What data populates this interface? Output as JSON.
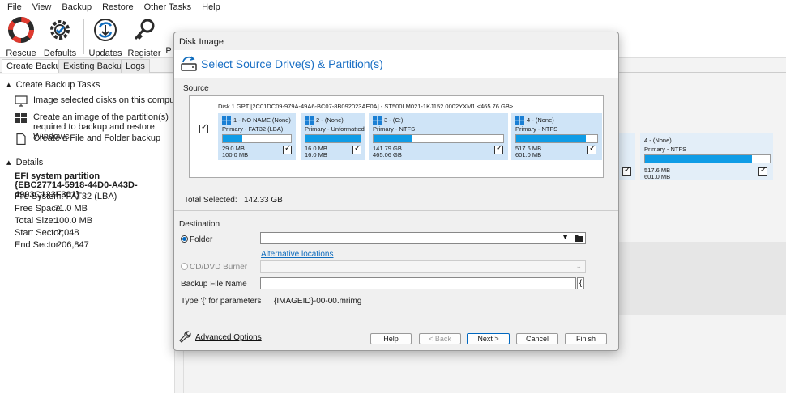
{
  "menu": [
    "File",
    "View",
    "Backup",
    "Restore",
    "Other Tasks",
    "Help"
  ],
  "toolbar": {
    "rescue": "Rescue",
    "defaults": "Defaults",
    "updates": "Updates",
    "register": "Register",
    "p_clipped": "P"
  },
  "tabs": [
    "Create Backups",
    "Existing Backups",
    "Logs"
  ],
  "left": {
    "tasks_header": "Create Backup Tasks",
    "task1": "Image selected disks on this computer",
    "task2": "Create an image of the partition(s) required to backup and restore Windows",
    "task3": "Create a File and Folder backup",
    "details_header": "Details",
    "partition_name": "EFI system partition",
    "partition_id": "{EBC27714-5918-44D0-A43D-4903C123F301}",
    "fs": "File System: FAT32 (LBA)",
    "free_label": "Free Space:",
    "free_val": "71.0 MB",
    "total_label": "Total Size:",
    "total_val": "100.0 MB",
    "start_label": "Start Sector:",
    "start_val": "2,048",
    "end_label": "End Sector:",
    "end_val": "206,847"
  },
  "bg_card": {
    "title": "4 - (None)",
    "type": "Primary - NTFS",
    "used": "517.6 MB",
    "total": "601.0 MB"
  },
  "dialog": {
    "title": "Disk Image",
    "header": "Select Source Drive(s) & Partition(s)",
    "source_label": "Source",
    "disk_info": "Disk 1 GPT [2C01DC09-979A-49A6-BC07-8B092023AE0A] - ST500LM021-1KJ152 0002YXM1  <465.76 GB>",
    "partitions": [
      {
        "title": "1 - NO NAME (None)",
        "type": "Primary - FAT32 (LBA)",
        "used": "29.0 MB",
        "total": "100.0 MB",
        "fill": 0.29
      },
      {
        "title": "2 - (None)",
        "type": "Primary - Unformatted",
        "used": "16.0 MB",
        "total": "16.0 MB",
        "fill": 1.0
      },
      {
        "title": "3 - (C:)",
        "type": "Primary - NTFS",
        "used": "141.79 GB",
        "total": "465.06 GB",
        "fill": 0.3
      },
      {
        "title": "4 - (None)",
        "type": "Primary - NTFS",
        "used": "517.6 MB",
        "total": "601.0 MB",
        "fill": 0.86
      }
    ],
    "total_selected_label": "Total Selected:",
    "total_selected_val": "142.33 GB",
    "destination_label": "Destination",
    "folder_label": "Folder",
    "alt_locations": "Alternative locations",
    "cd_label": "CD/DVD Burner",
    "backup_file_label": "Backup File Name",
    "brace_btn": "{",
    "type_hint": "Type '{' for parameters",
    "file_pattern": "{IMAGEID}-00-00.mrimg",
    "advanced": "Advanced Options",
    "btn_help": "Help",
    "btn_back": "< Back",
    "btn_next": "Next >",
    "btn_cancel": "Cancel",
    "btn_finish": "Finish"
  },
  "colors": {
    "accent": "#0f9ce6",
    "partition_bg": "#cfe4f7",
    "header_blue": "#1a6fc4"
  }
}
